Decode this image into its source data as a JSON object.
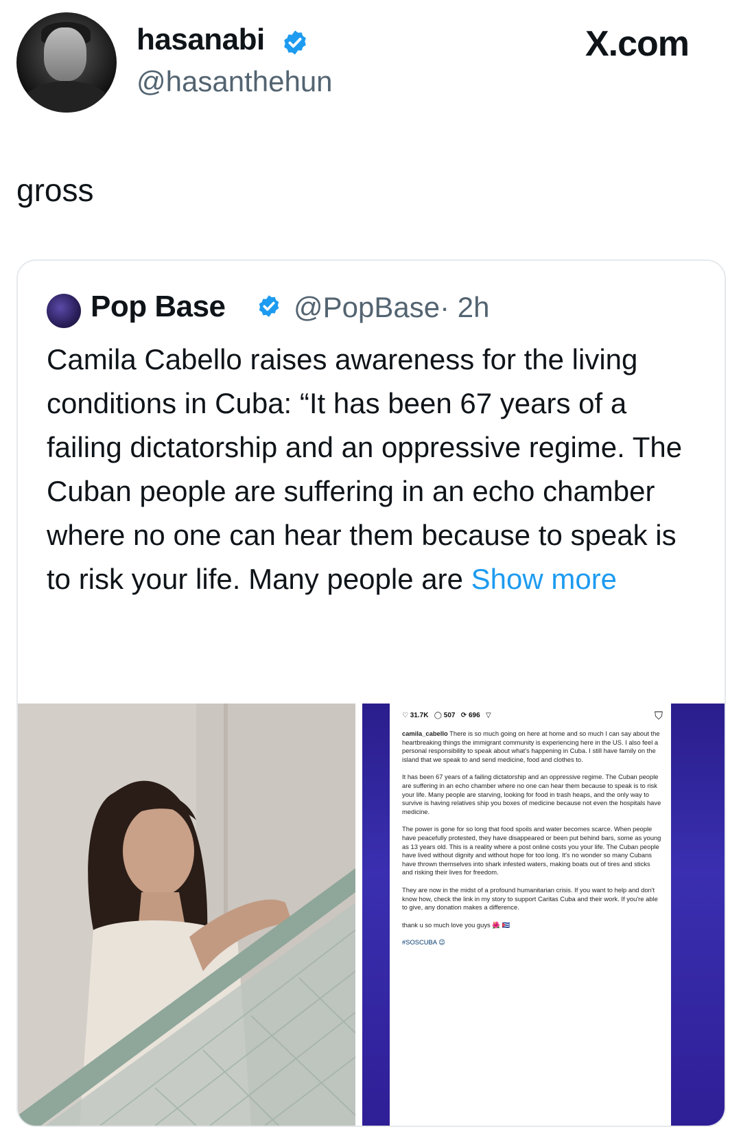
{
  "tweet": {
    "author_name": "hasanabi",
    "author_handle": "@hasanthehun",
    "source": "X.com",
    "text": "gross"
  },
  "quoted_tweet": {
    "author_name": "Pop Base",
    "author_handle": "@PopBase",
    "time": "· 2h",
    "body": "Camila Cabello raises awareness for the living conditions in Cuba: “It has been 67 years of a failing dictatorship and an oppressive regime. The Cuban people are suffering in an echo chamber where no one can hear them because to speak is to risk your life. Many people are ",
    "show_more": "Show more"
  },
  "instagram_screenshot": {
    "likes": "31.7K",
    "comments": "507",
    "shares": "696",
    "username": "camila_cabello",
    "paragraph1": "There is so much going on here at home and so much I can say about the heartbreaking things the immigrant community is experiencing here in the US. I also feel a personal responsibility to speak about what's happening in Cuba. I still have family on the island that we speak to and send medicine, food and clothes to.",
    "paragraph2": "It has been 67 years of a failing dictatorship and an oppressive regime. The Cuban people are suffering in an echo chamber where no one can hear them because to speak is to risk your life. Many people are starving, looking for food in trash heaps, and the only way to survive is having relatives ship you boxes of medicine because not even the hospitals have medicine.",
    "paragraph3": "The power is gone for so long that food spoils and water becomes scarce. When people have peacefully protested, they have disappeared or been put behind bars, some as young as 13 years old. This is a reality where a post online costs you your life. The Cuban people have lived without dignity and without hope for too long. It's no wonder so many Cubans have thrown themselves into shark infested waters, making boats out of tires and sticks and risking their lives for freedom.",
    "paragraph4": "They are now in the midst of a profound humanitarian crisis. If you want to help and don't know how, check the link in my story to support Caritas Cuba and their work. If you're able to give, any donation makes a difference.",
    "signoff": "thank u so much love you guys 🌺 🇨🇺",
    "hashtag": "#SOSCUBA 😉"
  },
  "colors": {
    "verified": "#1d9bf0",
    "link": "#1d9bf0",
    "secondary_text": "#536471"
  }
}
